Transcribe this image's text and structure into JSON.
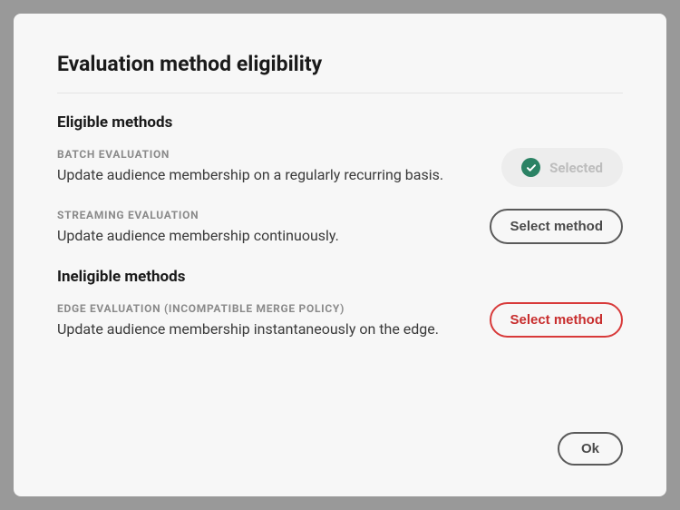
{
  "dialog": {
    "title": "Evaluation method eligibility",
    "eligible_heading": "Eligible methods",
    "ineligible_heading": "Ineligible methods",
    "ok_label": "Ok"
  },
  "methods": {
    "batch": {
      "label": "BATCH EVALUATION",
      "description": "Update audience membership on a regularly recurring basis.",
      "button_label": "Selected"
    },
    "streaming": {
      "label": "STREAMING EVALUATION",
      "description": "Update audience membership continuously.",
      "button_label": "Select method"
    },
    "edge": {
      "label": "EDGE EVALUATION (INCOMPATIBLE MERGE POLICY)",
      "description": "Update audience membership instantaneously on the edge.",
      "button_label": "Select method"
    }
  },
  "colors": {
    "accent_green": "#2b8264",
    "danger_red": "#d83a3a"
  }
}
